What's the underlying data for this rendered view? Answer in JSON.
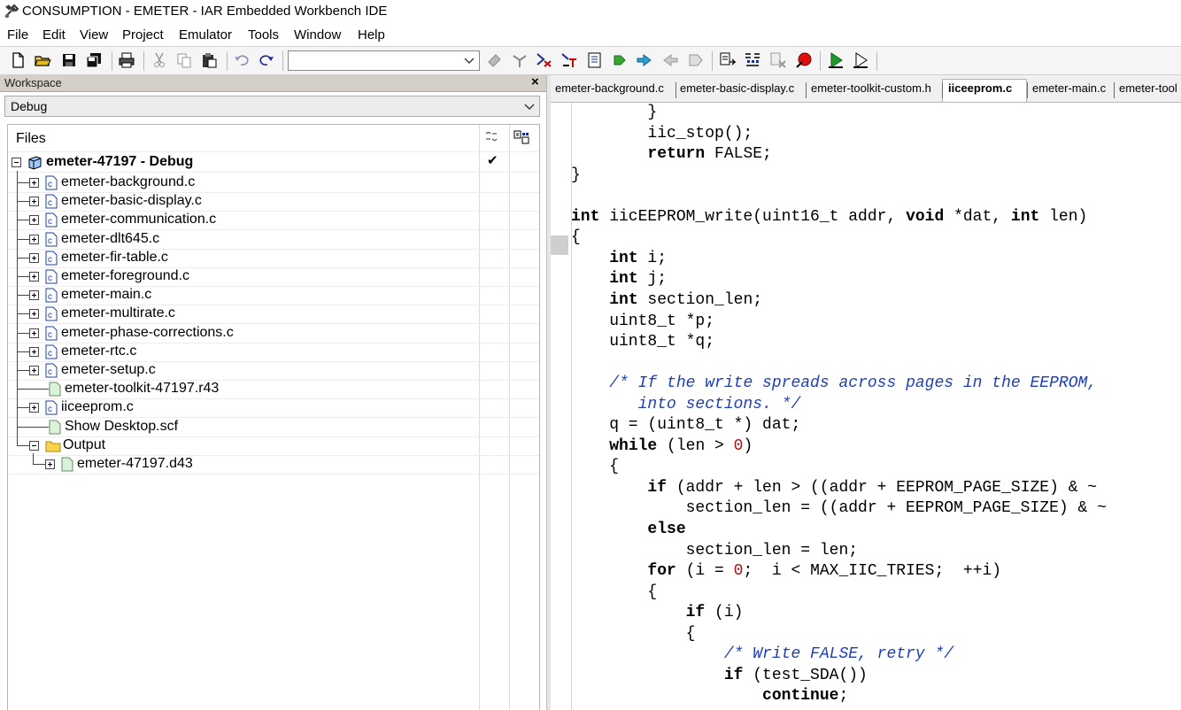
{
  "window": {
    "title": "CONSUMPTION - EMETER - IAR Embedded Workbench IDE"
  },
  "menu": [
    "File",
    "Edit",
    "View",
    "Project",
    "Emulator",
    "Tools",
    "Window",
    "Help"
  ],
  "toolbar": {
    "combo_value": ""
  },
  "workspace": {
    "title": "Workspace",
    "close_label": "×",
    "config": "Debug",
    "files_header": "Files",
    "project": "emeter-47197 - Debug",
    "project_check": "✔",
    "items": [
      {
        "label": "emeter-background.c",
        "type": "c"
      },
      {
        "label": "emeter-basic-display.c",
        "type": "c"
      },
      {
        "label": "emeter-communication.c",
        "type": "c"
      },
      {
        "label": "emeter-dlt645.c",
        "type": "c"
      },
      {
        "label": "emeter-fir-table.c",
        "type": "c"
      },
      {
        "label": "emeter-foreground.c",
        "type": "c"
      },
      {
        "label": "emeter-main.c",
        "type": "c"
      },
      {
        "label": "emeter-multirate.c",
        "type": "c"
      },
      {
        "label": "emeter-phase-corrections.c",
        "type": "c"
      },
      {
        "label": "emeter-rtc.c",
        "type": "c"
      },
      {
        "label": "emeter-setup.c",
        "type": "c"
      },
      {
        "label": "emeter-toolkit-47197.r43",
        "type": "file"
      },
      {
        "label": "iiceeprom.c",
        "type": "c"
      },
      {
        "label": "Show Desktop.scf",
        "type": "file"
      },
      {
        "label": "Output",
        "type": "folder"
      },
      {
        "label": "emeter-47197.d43",
        "type": "output"
      }
    ]
  },
  "editor": {
    "tabs": [
      "emeter-background.c",
      "emeter-basic-display.c",
      "emeter-toolkit-custom.h",
      "iiceeprom.c",
      "emeter-main.c",
      "emeter-tool"
    ],
    "active_tab": "iiceeprom.c",
    "lines": [
      [
        [
          "t",
          "        }"
        ]
      ],
      [
        [
          "t",
          "        iic_stop();"
        ]
      ],
      [
        [
          "t",
          "        "
        ],
        [
          "kw",
          "return"
        ],
        [
          "t",
          " FALSE;"
        ]
      ],
      [
        [
          "t",
          "}"
        ]
      ],
      [
        [
          "t",
          ""
        ]
      ],
      [
        [
          "kw",
          "int"
        ],
        [
          "t",
          " iicEEPROM_write(uint16_t addr, "
        ],
        [
          "kw",
          "void"
        ],
        [
          "t",
          " *dat, "
        ],
        [
          "kw",
          "int"
        ],
        [
          "t",
          " len)"
        ]
      ],
      [
        [
          "t",
          "{"
        ]
      ],
      [
        [
          "t",
          "    "
        ],
        [
          "kw",
          "int"
        ],
        [
          "t",
          " i;"
        ]
      ],
      [
        [
          "t",
          "    "
        ],
        [
          "kw",
          "int"
        ],
        [
          "t",
          " j;"
        ]
      ],
      [
        [
          "t",
          "    "
        ],
        [
          "kw",
          "int"
        ],
        [
          "t",
          " section_len;"
        ]
      ],
      [
        [
          "t",
          "    uint8_t *p;"
        ]
      ],
      [
        [
          "t",
          "    uint8_t *q;"
        ]
      ],
      [
        [
          "t",
          ""
        ]
      ],
      [
        [
          "t",
          "    "
        ],
        [
          "cm",
          "/* If the write spreads across pages in the EEPROM,"
        ]
      ],
      [
        [
          "cm",
          "       into sections. */"
        ]
      ],
      [
        [
          "t",
          "    q = (uint8_t *) dat;"
        ]
      ],
      [
        [
          "t",
          "    "
        ],
        [
          "kw",
          "while"
        ],
        [
          "t",
          " (len > "
        ],
        [
          "nm",
          "0"
        ],
        [
          "t",
          ")"
        ]
      ],
      [
        [
          "t",
          "    {"
        ]
      ],
      [
        [
          "t",
          "        "
        ],
        [
          "kw",
          "if"
        ],
        [
          "t",
          " (addr + len > ((addr + EEPROM_PAGE_SIZE) & ~"
        ]
      ],
      [
        [
          "t",
          "            section_len = ((addr + EEPROM_PAGE_SIZE) & ~"
        ]
      ],
      [
        [
          "t",
          "        "
        ],
        [
          "kw",
          "else"
        ]
      ],
      [
        [
          "t",
          "            section_len = len;"
        ]
      ],
      [
        [
          "t",
          "        "
        ],
        [
          "kw",
          "for"
        ],
        [
          "t",
          " (i = "
        ],
        [
          "nm",
          "0"
        ],
        [
          "t",
          ";  i < MAX_IIC_TRIES;  ++i)"
        ]
      ],
      [
        [
          "t",
          "        {"
        ]
      ],
      [
        [
          "t",
          "            "
        ],
        [
          "kw",
          "if"
        ],
        [
          "t",
          " (i)"
        ]
      ],
      [
        [
          "t",
          "            {"
        ]
      ],
      [
        [
          "t",
          "                "
        ],
        [
          "cm",
          "/* Write FALSE, retry */"
        ]
      ],
      [
        [
          "t",
          "                "
        ],
        [
          "kw",
          "if"
        ],
        [
          "t",
          " (test_SDA())"
        ]
      ],
      [
        [
          "t",
          "                    "
        ],
        [
          "kw",
          "continue"
        ],
        [
          "t",
          ";"
        ]
      ]
    ]
  },
  "icons": {
    "toolbar": [
      "new-file-icon",
      "open-folder-icon",
      "save-icon",
      "save-all-icon",
      "print-icon",
      "cut-icon",
      "copy-icon",
      "paste-icon",
      "undo-icon",
      "redo-icon",
      "find-icon",
      "find-in-files-icon",
      "toggle-bookmark-icon",
      "goto-bookmark-icon",
      "navigate-back-icon",
      "navigate-forward-icon",
      "compile-icon",
      "make-icon",
      "stop-build-icon",
      "toggle-breakpoint-icon",
      "debug-icon",
      "debug-without-download-icon"
    ]
  }
}
